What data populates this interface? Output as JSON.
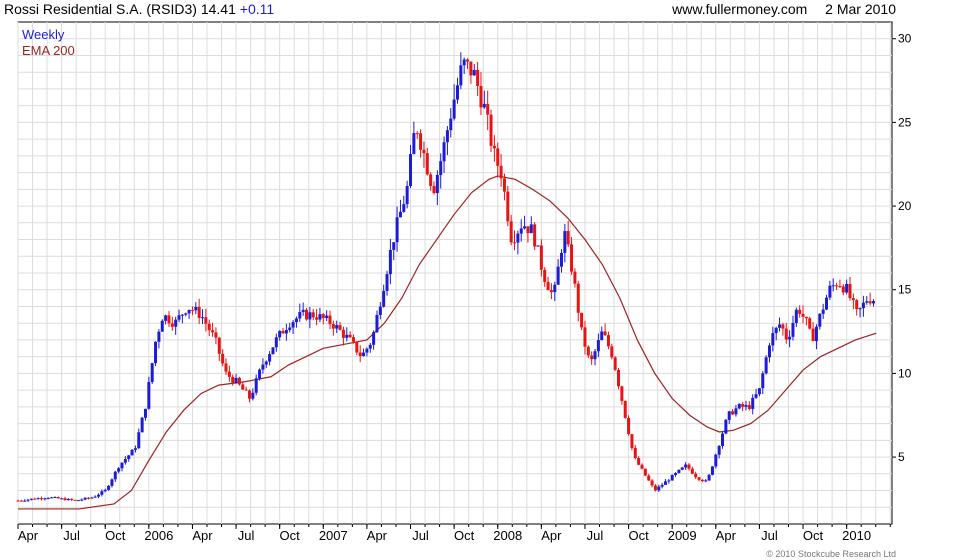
{
  "header": {
    "ticker_line": "Rossi Residential S.A. (RSID3) 14.41",
    "change": "+0.11",
    "site": "www.fullermoney.com",
    "date": "2 Mar 2010"
  },
  "legend": {
    "weekly": "Weekly",
    "ema": "EMA 200"
  },
  "copyright": "© 2010 Stockcube Research Ltd",
  "colors": {
    "up": "#1c1cd6",
    "down": "#e81313",
    "ema": "#9c2323",
    "grid": "#dcdcdc",
    "axis": "#000000"
  },
  "chart_data": {
    "type": "candlestick",
    "ylim": [
      1,
      31
    ],
    "yticks": [
      5,
      10,
      15,
      20,
      25,
      30
    ],
    "xlim": [
      2005.25,
      2010.26
    ],
    "xticks": [
      {
        "t": 2005.25,
        "label": "Apr"
      },
      {
        "t": 2005.5,
        "label": "Jul"
      },
      {
        "t": 2005.75,
        "label": "Oct"
      },
      {
        "t": 2006.0,
        "label": "2006"
      },
      {
        "t": 2006.25,
        "label": "Apr"
      },
      {
        "t": 2006.5,
        "label": "Jul"
      },
      {
        "t": 2006.75,
        "label": "Oct"
      },
      {
        "t": 2007.0,
        "label": "2007"
      },
      {
        "t": 2007.25,
        "label": "Apr"
      },
      {
        "t": 2007.5,
        "label": "Jul"
      },
      {
        "t": 2007.75,
        "label": "Oct"
      },
      {
        "t": 2008.0,
        "label": "2008"
      },
      {
        "t": 2008.25,
        "label": "Apr"
      },
      {
        "t": 2008.5,
        "label": "Jul"
      },
      {
        "t": 2008.75,
        "label": "Oct"
      },
      {
        "t": 2009.0,
        "label": "2009"
      },
      {
        "t": 2009.25,
        "label": "Apr"
      },
      {
        "t": 2009.5,
        "label": "Jul"
      },
      {
        "t": 2009.75,
        "label": "Oct"
      },
      {
        "t": 2010.0,
        "label": "2010"
      }
    ],
    "price_path": [
      [
        2005.25,
        2.4
      ],
      [
        2005.42,
        2.6
      ],
      [
        2005.58,
        2.4
      ],
      [
        2005.68,
        2.6
      ],
      [
        2005.75,
        3.0
      ],
      [
        2005.83,
        4.5
      ],
      [
        2005.92,
        5.5
      ],
      [
        2005.98,
        8.0
      ],
      [
        2006.04,
        12.0
      ],
      [
        2006.08,
        13.5
      ],
      [
        2006.15,
        13.0
      ],
      [
        2006.22,
        14.0
      ],
      [
        2006.3,
        13.5
      ],
      [
        2006.38,
        12.0
      ],
      [
        2006.44,
        10.0
      ],
      [
        2006.5,
        9.5
      ],
      [
        2006.58,
        8.5
      ],
      [
        2006.65,
        10.5
      ],
      [
        2006.73,
        12.0
      ],
      [
        2006.8,
        13.0
      ],
      [
        2006.88,
        13.5
      ],
      [
        2006.95,
        13.5
      ],
      [
        2007.05,
        13.0
      ],
      [
        2007.15,
        12.0
      ],
      [
        2007.22,
        11.0
      ],
      [
        2007.28,
        12.0
      ],
      [
        2007.34,
        15.0
      ],
      [
        2007.4,
        18.0
      ],
      [
        2007.48,
        21.0
      ],
      [
        2007.53,
        25.0
      ],
      [
        2007.58,
        23.0
      ],
      [
        2007.63,
        21.0
      ],
      [
        2007.68,
        23.0
      ],
      [
        2007.74,
        26.0
      ],
      [
        2007.8,
        28.5
      ],
      [
        2007.86,
        28.0
      ],
      [
        2007.92,
        26.0
      ],
      [
        2007.98,
        23.0
      ],
      [
        2008.02,
        22.0
      ],
      [
        2008.08,
        18.0
      ],
      [
        2008.14,
        19.0
      ],
      [
        2008.2,
        18.5
      ],
      [
        2008.26,
        16.0
      ],
      [
        2008.32,
        14.5
      ],
      [
        2008.38,
        18.5
      ],
      [
        2008.43,
        16.0
      ],
      [
        2008.48,
        12.5
      ],
      [
        2008.53,
        10.5
      ],
      [
        2008.6,
        12.5
      ],
      [
        2008.66,
        11.0
      ],
      [
        2008.72,
        8.0
      ],
      [
        2008.78,
        5.0
      ],
      [
        2008.84,
        4.0
      ],
      [
        2008.9,
        3.0
      ],
      [
        2008.96,
        3.5
      ],
      [
        2009.02,
        4.0
      ],
      [
        2009.08,
        4.5
      ],
      [
        2009.14,
        3.8
      ],
      [
        2009.2,
        3.5
      ],
      [
        2009.26,
        5.5
      ],
      [
        2009.32,
        7.5
      ],
      [
        2009.38,
        8.0
      ],
      [
        2009.44,
        8.0
      ],
      [
        2009.5,
        9.0
      ],
      [
        2009.56,
        12.0
      ],
      [
        2009.62,
        13.0
      ],
      [
        2009.66,
        12.0
      ],
      [
        2009.72,
        14.0
      ],
      [
        2009.77,
        13.0
      ],
      [
        2009.8,
        12.0
      ],
      [
        2009.85,
        13.5
      ],
      [
        2009.9,
        15.0
      ],
      [
        2009.95,
        15.5
      ],
      [
        2010.0,
        15.0
      ],
      [
        2010.06,
        13.5
      ],
      [
        2010.12,
        14.5
      ],
      [
        2010.17,
        14.4
      ]
    ],
    "ema_path": [
      [
        2005.25,
        1.9
      ],
      [
        2005.6,
        1.9
      ],
      [
        2005.8,
        2.2
      ],
      [
        2005.9,
        3.0
      ],
      [
        2006.0,
        4.8
      ],
      [
        2006.1,
        6.5
      ],
      [
        2006.2,
        7.8
      ],
      [
        2006.3,
        8.8
      ],
      [
        2006.4,
        9.3
      ],
      [
        2006.55,
        9.5
      ],
      [
        2006.7,
        9.8
      ],
      [
        2006.8,
        10.5
      ],
      [
        2006.9,
        11.0
      ],
      [
        2007.0,
        11.5
      ],
      [
        2007.15,
        11.8
      ],
      [
        2007.25,
        12.0
      ],
      [
        2007.35,
        13.0
      ],
      [
        2007.45,
        14.5
      ],
      [
        2007.55,
        16.5
      ],
      [
        2007.65,
        18.0
      ],
      [
        2007.75,
        19.5
      ],
      [
        2007.85,
        20.8
      ],
      [
        2007.95,
        21.6
      ],
      [
        2008.0,
        21.8
      ],
      [
        2008.1,
        21.6
      ],
      [
        2008.2,
        21.0
      ],
      [
        2008.3,
        20.3
      ],
      [
        2008.4,
        19.3
      ],
      [
        2008.5,
        18.0
      ],
      [
        2008.6,
        16.5
      ],
      [
        2008.7,
        14.5
      ],
      [
        2008.8,
        12.0
      ],
      [
        2008.9,
        10.0
      ],
      [
        2009.0,
        8.5
      ],
      [
        2009.1,
        7.5
      ],
      [
        2009.2,
        6.8
      ],
      [
        2009.27,
        6.5
      ],
      [
        2009.35,
        6.6
      ],
      [
        2009.45,
        7.0
      ],
      [
        2009.55,
        7.8
      ],
      [
        2009.65,
        9.0
      ],
      [
        2009.75,
        10.2
      ],
      [
        2009.85,
        11.0
      ],
      [
        2009.95,
        11.5
      ],
      [
        2010.05,
        12.0
      ],
      [
        2010.17,
        12.4
      ]
    ]
  }
}
